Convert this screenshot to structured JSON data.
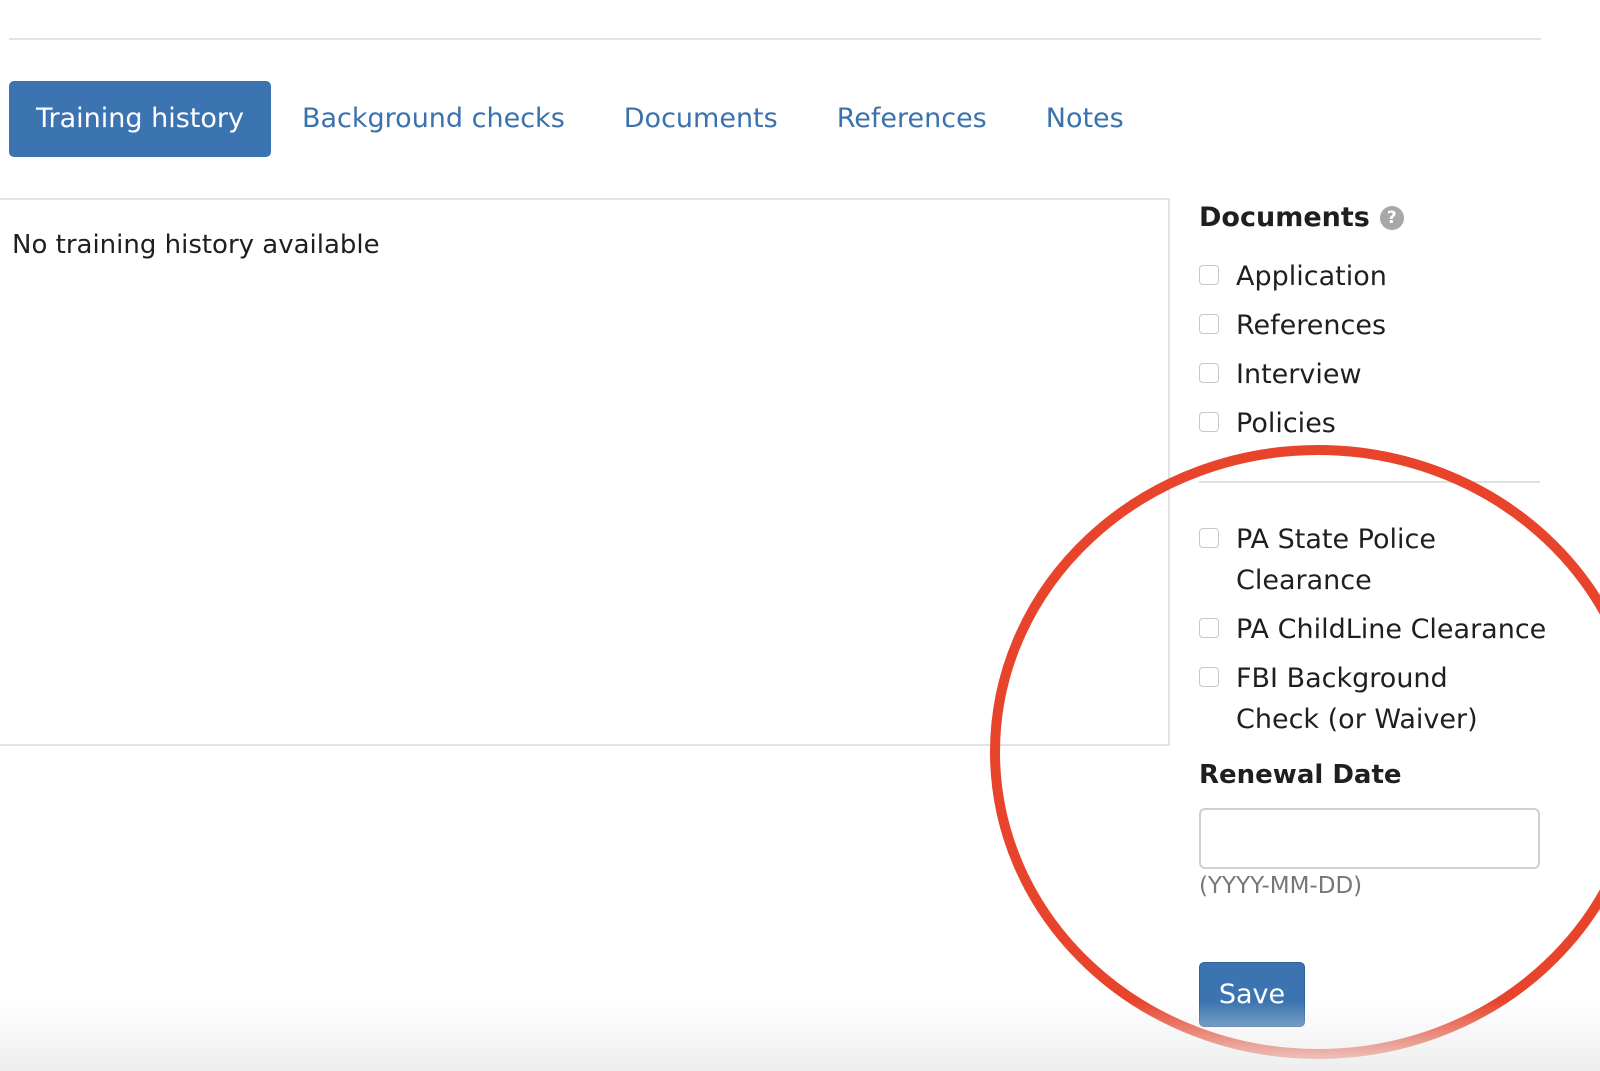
{
  "tabs": [
    {
      "label": "Training history",
      "active": true
    },
    {
      "label": "Background checks",
      "active": false
    },
    {
      "label": "Documents",
      "active": false
    },
    {
      "label": "References",
      "active": false
    },
    {
      "label": "Notes",
      "active": false
    }
  ],
  "training_history": {
    "empty_message": "No training history available"
  },
  "sidebar": {
    "heading": "Documents",
    "help_icon": "question-circle-icon",
    "documents": [
      {
        "label": "Application",
        "checked": false
      },
      {
        "label": "References",
        "checked": false
      },
      {
        "label": "Interview",
        "checked": false
      },
      {
        "label": "Policies",
        "checked": false
      }
    ],
    "clearances": [
      {
        "label": "PA State Police Clearance",
        "checked": false
      },
      {
        "label": "PA ChildLine Clearance",
        "checked": false
      },
      {
        "label": "FBI Background Check (or Waiver)",
        "checked": false
      }
    ],
    "renewal_date": {
      "label": "Renewal Date",
      "value": "",
      "hint": "(YYYY-MM-DD)"
    },
    "save_label": "Save"
  },
  "colors": {
    "accent": "#3b74b0",
    "link": "#3a72ae",
    "annotation": "#e8432b"
  }
}
